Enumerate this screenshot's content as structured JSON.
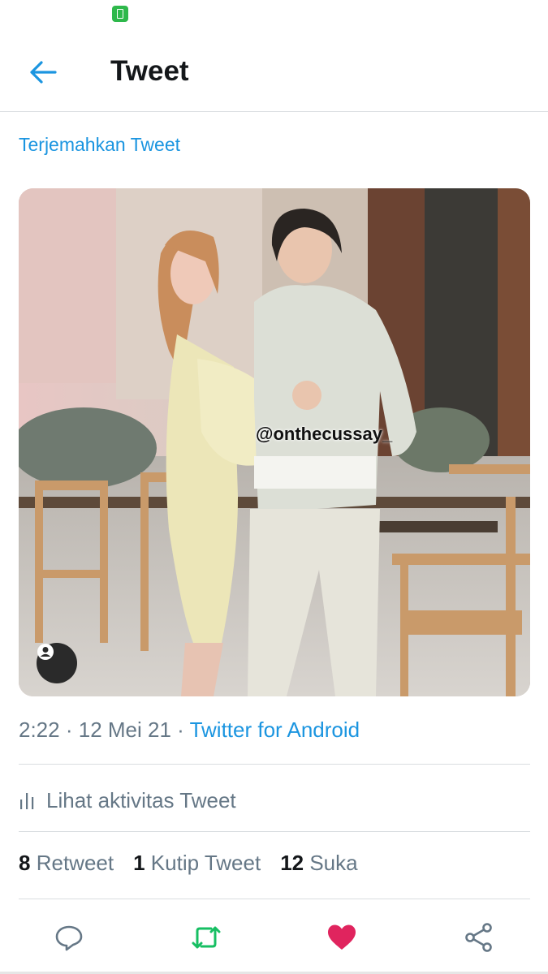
{
  "header": {
    "title": "Tweet",
    "back_icon": "arrow-left-icon"
  },
  "tweet": {
    "translate_label": "Terjemahkan Tweet",
    "media_watermark": "@onthecussay_",
    "time": "2:22",
    "date": "12 Mei 21",
    "source": "Twitter for Android",
    "activity_label": "Lihat aktivitas Tweet",
    "stats": {
      "retweet_count": "8",
      "retweet_label": "Retweet",
      "quote_count": "1",
      "quote_label": "Kutip Tweet",
      "like_count": "12",
      "like_label": "Suka"
    }
  },
  "actions": {
    "reply_icon": "reply-icon",
    "retweet_icon": "retweet-icon",
    "like_icon": "heart-icon",
    "share_icon": "share-icon"
  },
  "colors": {
    "accent": "#1b95e0",
    "retweet_active": "#17bf63",
    "like_active": "#e0245e",
    "battery": "#2eb84b"
  }
}
